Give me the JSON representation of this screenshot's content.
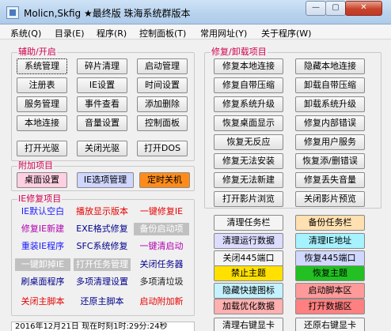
{
  "window": {
    "title": "Molicn,Skfig ★最终版 珠海系统群版本",
    "minimize": "—",
    "maximize": "▢",
    "close": "✕"
  },
  "menu": [
    "系统(Q)",
    "目录(E)",
    "程序(R)",
    "控制面板(T)",
    "常用网址(Y)",
    "关于程序(W)"
  ],
  "group_aux": {
    "title": "辅助/开启",
    "buttons": [
      "系统管理",
      "碎片清理",
      "启动管理",
      "注册表",
      "IE设置",
      "时间设置",
      "服务管理",
      "事件查看",
      "添加删除",
      "本地连接",
      "音量设置",
      "控制面板",
      "打开光驱",
      "关闭光驱",
      "打开DOS"
    ]
  },
  "group_extra": {
    "title": "附加项目",
    "buttons": [
      {
        "label": "桌面设置",
        "bg": "#ffd0e2"
      },
      {
        "label": "IE选项管理",
        "bg": "#cfd6ff"
      },
      {
        "label": "定时关机",
        "bg": "#ff8c1a"
      }
    ]
  },
  "group_ie": {
    "title": "IE修复项目",
    "items": [
      {
        "label": "IE默认空白",
        "color": "#1a1aff",
        "bg": ""
      },
      {
        "label": "播放显示版本",
        "color": "#e60000",
        "bg": ""
      },
      {
        "label": "一键修复IE",
        "color": "#e60000",
        "bg": ""
      },
      {
        "label": "修复IE新建",
        "color": "#b000b0",
        "bg": ""
      },
      {
        "label": "EXE格式修复",
        "color": "#00008b",
        "bg": ""
      },
      {
        "label": "备份启动项",
        "color": "#ffffff",
        "bg": "#c0c0c0"
      },
      {
        "label": "重装IE程序",
        "color": "#1a1aff",
        "bg": ""
      },
      {
        "label": "SFC系统修复",
        "color": "#00008b",
        "bg": ""
      },
      {
        "label": "一键清启动",
        "color": "#b000b0",
        "bg": ""
      },
      {
        "label": "一键卸掉IE",
        "color": "#ffffff",
        "bg": "#c0c0c0"
      },
      {
        "label": "打开任务管理",
        "color": "#ffffff",
        "bg": "#c0c0c0"
      },
      {
        "label": "关闭任务器",
        "color": "#00008b",
        "bg": ""
      },
      {
        "label": "刷桌面程序",
        "color": "#00008b",
        "bg": ""
      },
      {
        "label": "多项清理设置",
        "color": "#00008b",
        "bg": ""
      },
      {
        "label": "多项清垃圾",
        "color": "#1a1a1a",
        "bg": ""
      },
      {
        "label": "关闭主脚本",
        "color": "#e60000",
        "bg": ""
      },
      {
        "label": "还原主脚本",
        "color": "#00008b",
        "bg": ""
      },
      {
        "label": "启动附加新",
        "color": "#e60000",
        "bg": ""
      }
    ]
  },
  "group_repair": {
    "title": "修复/卸载项目",
    "buttons": [
      "修复本地连接",
      "隐藏本地连接",
      "修复自带压缩",
      "卸载自带压缩",
      "修复系统升级",
      "卸载系统升级",
      "恢复桌面显示",
      "修复内部错误",
      "恢复无反应",
      "修复用户服务",
      "修复无法安装",
      "恢复添/删错误",
      "修复无法新建",
      "修复丢失音量",
      "打开影片浏览",
      "关闭影片预览"
    ]
  },
  "colored_buttons": [
    {
      "label": "清理任务栏",
      "bg": "#f4f4f4",
      "color": "#000000"
    },
    {
      "label": "备份任务栏",
      "bg": "#ffe0b0",
      "color": "#000000"
    },
    {
      "label": "清理运行数据",
      "bg": "#dcdcff",
      "color": "#000000"
    },
    {
      "label": "清理IE地址",
      "bg": "#a6f2ff",
      "color": "#000000"
    },
    {
      "label": "关闭445端口",
      "bg": "#f4f4f4",
      "color": "#000000"
    },
    {
      "label": "恢复445端口",
      "bg": "#d0d8ff",
      "color": "#000000"
    },
    {
      "label": "禁止主题",
      "bg": "#ffe000",
      "color": "#000000"
    },
    {
      "label": "恢复主题",
      "bg": "#22c022",
      "color": "#000000"
    },
    {
      "label": "隐藏快捷图标",
      "bg": "#c4f2ff",
      "color": "#000000"
    },
    {
      "label": "启动脚本区",
      "bg": "#ff9a9a",
      "color": "#000000"
    },
    {
      "label": "加载优化数据",
      "bg": "#ffb0b0",
      "color": "#000000"
    },
    {
      "label": "打开数据区",
      "bg": "#ff8080",
      "color": "#000000"
    },
    {
      "label": "清理右键显卡",
      "bg": "#f4f4f4",
      "color": "#000000"
    },
    {
      "label": "还原右键显卡",
      "bg": "#f4f4f4",
      "color": "#000000"
    }
  ],
  "status": {
    "text": "2016年12月21日 现在时刻1时:29分:24秒"
  }
}
